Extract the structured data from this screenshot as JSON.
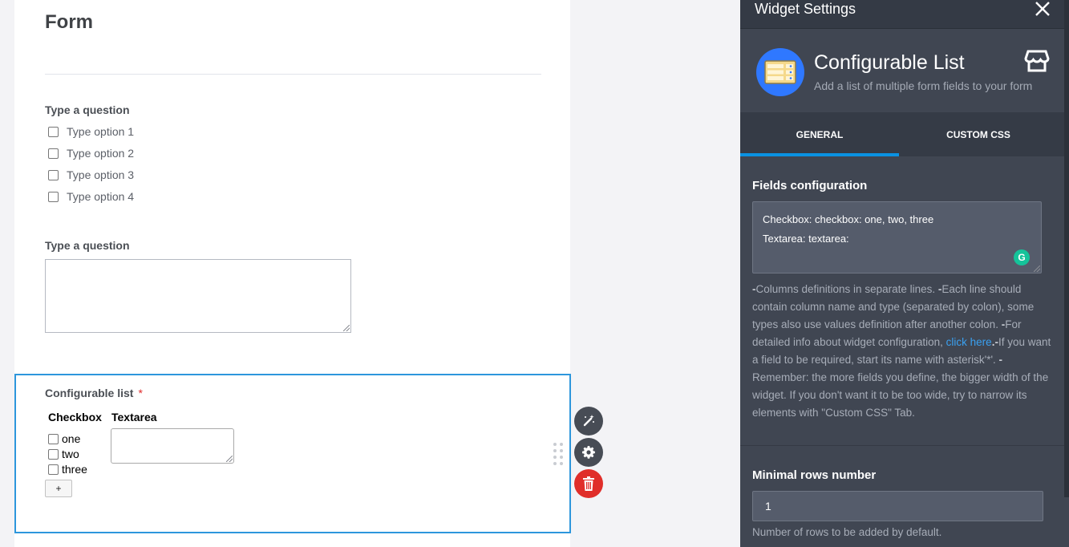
{
  "form": {
    "title": "Form",
    "question1": {
      "label": "Type a question",
      "options": [
        "Type option 1",
        "Type option 2",
        "Type option 3",
        "Type option 4"
      ]
    },
    "question2": {
      "label": "Type a question"
    },
    "widget": {
      "label": "Configurable list",
      "required_mark": "*",
      "columns": [
        "Checkbox",
        "Textarea"
      ],
      "checkbox_options": [
        "one",
        "two",
        "three"
      ],
      "add_button": "+"
    }
  },
  "panel": {
    "title": "Widget Settings",
    "widget_name": "Configurable List",
    "widget_description": "Add a list of multiple form fields to your form",
    "tabs": [
      {
        "label": "GENERAL",
        "active": true
      },
      {
        "label": "CUSTOM CSS",
        "active": false
      }
    ],
    "fields_config": {
      "label": "Fields configuration",
      "lines": [
        "Checkbox: checkbox: one, two, three",
        "Textarea: textarea:"
      ],
      "help_parts": {
        "p1": "Columns definitions in separate lines. ",
        "p2": "Each line should contain column name and type (separated by colon), some types also use values definition after another colon. ",
        "p3": "For detailed info about widget configuration, ",
        "link": "click here",
        "p4": "If you want a field to be required, start its name with asterisk'*'. ",
        "p5": "Remember: the more fields you define, the bigger width of the widget. If you don't want it to be too wide, try to narrow its elements with \"Custom CSS\" Tab."
      }
    },
    "min_rows": {
      "label": "Minimal rows number",
      "value": "1",
      "help": "Number of rows to be added by default."
    }
  },
  "colors": {
    "accent": "#2d96dc",
    "panel_bg": "#404652",
    "delete": "#e02e2a",
    "widget_icon_bg": "#2f78ff",
    "grammarly": "#15c39a"
  }
}
